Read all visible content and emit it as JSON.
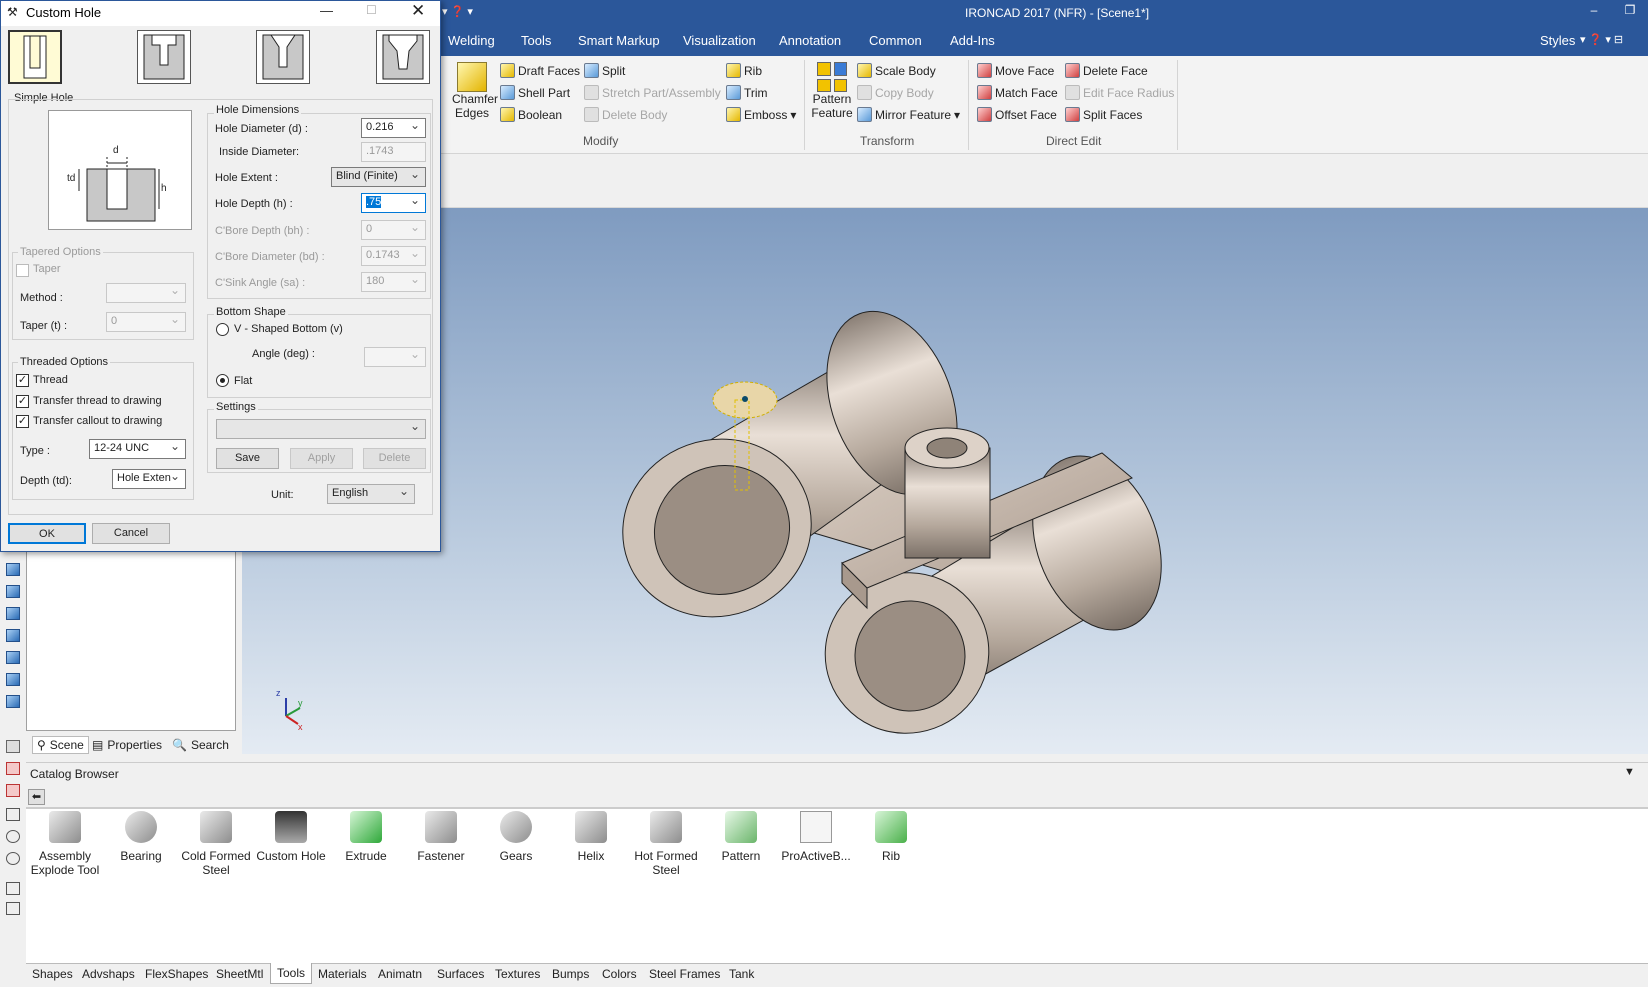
{
  "app": {
    "title": "IRONCAD 2017 (NFR) - [Scene1*]"
  },
  "menu": [
    "Welding",
    "Tools",
    "Smart Markup",
    "Visualization",
    "Annotation",
    "Common",
    "Add-Ins"
  ],
  "menu_right": {
    "styles": "Styles"
  },
  "ribbon": {
    "chamfer": [
      "Chamfer",
      "Edges"
    ],
    "modify": {
      "col1": [
        "Draft Faces",
        "Shell Part",
        "Boolean"
      ],
      "col2": [
        "Split",
        "Stretch Part/Assembly",
        "Delete Body"
      ],
      "col3": [
        "Rib",
        "Trim",
        "Emboss"
      ],
      "label": "Modify"
    },
    "transform": {
      "pattern": [
        "Pattern",
        "Feature"
      ],
      "col": [
        "Scale Body",
        "Copy Body",
        "Mirror Feature"
      ],
      "label": "Transform"
    },
    "directedit": {
      "col1": [
        "Move Face",
        "Match Face",
        "Offset Face"
      ],
      "col2": [
        "Delete Face",
        "Edit Face Radius",
        "Split Faces"
      ],
      "label": "Direct Edit"
    }
  },
  "panel_tabs": [
    "Scene",
    "Properties",
    "Search"
  ],
  "catalog": {
    "title": "Catalog Browser",
    "items": [
      [
        "Assembly",
        "Explode Tool"
      ],
      [
        "Bearing",
        ""
      ],
      [
        "Cold Formed",
        "Steel"
      ],
      [
        "Custom Hole",
        ""
      ],
      [
        "Extrude",
        ""
      ],
      [
        "Fastener",
        ""
      ],
      [
        "Gears",
        ""
      ],
      [
        "Helix",
        ""
      ],
      [
        "Hot Formed",
        "Steel"
      ],
      [
        "Pattern",
        ""
      ],
      [
        "ProActiveB...",
        ""
      ],
      [
        "Rib",
        ""
      ]
    ],
    "tabs": [
      "Shapes",
      "Advshaps",
      "FlexShapes",
      "SheetMtl",
      "Tools",
      "Materials",
      "Animatn",
      "Surfaces",
      "Textures",
      "Bumps",
      "Colors",
      "Steel Frames",
      "Tank"
    ],
    "active_tab": "Tools"
  },
  "dialog": {
    "title": "Custom Hole",
    "hole_type": "Simple Hole",
    "diagram": {
      "d": "d",
      "td": "td",
      "h": "h"
    },
    "hole_dimensions": {
      "title": "Hole Dimensions",
      "diameter_label": "Hole Diameter (d) :",
      "diameter": "0.216",
      "inside_label": "Inside Diameter:",
      "inside": ".1743",
      "extent_label": "Hole Extent :",
      "extent": "Blind (Finite)",
      "depth_label": "Hole Depth (h) :",
      "depth": ".75",
      "cbore_depth_label": "C'Bore Depth (bh) :",
      "cbore_depth": "0",
      "cbore_dia_label": "C'Bore Diameter (bd) :",
      "cbore_dia": "0.1743",
      "csink_label": "C'Sink Angle (sa) :",
      "csink": "180"
    },
    "tapered": {
      "title": "Tapered Options",
      "taper": "Taper",
      "method_label": "Method :",
      "method": "",
      "taper_label": "Taper (t) :",
      "taper_value": "0"
    },
    "threaded": {
      "title": "Threaded Options",
      "thread": "Thread",
      "transfer_thread": "Transfer thread to drawing",
      "transfer_callout": "Transfer callout to drawing",
      "type_label": "Type :",
      "type": "12-24 UNC",
      "depth_label": "Depth (td):",
      "depth": "Hole Exten",
      "checked": [
        true,
        true,
        true
      ]
    },
    "bottom": {
      "title": "Bottom Shape",
      "v": "V - Shaped Bottom (v)",
      "angle_label": "Angle (deg) :",
      "angle": "",
      "flat": "Flat",
      "selected": "Flat"
    },
    "settings": {
      "title": "Settings",
      "value": "",
      "save": "Save",
      "apply": "Apply",
      "delete": "Delete"
    },
    "unit_label": "Unit:",
    "unit": "English",
    "ok": "OK",
    "cancel": "Cancel"
  },
  "triad": {
    "x": "x",
    "y": "y",
    "z": "z"
  }
}
